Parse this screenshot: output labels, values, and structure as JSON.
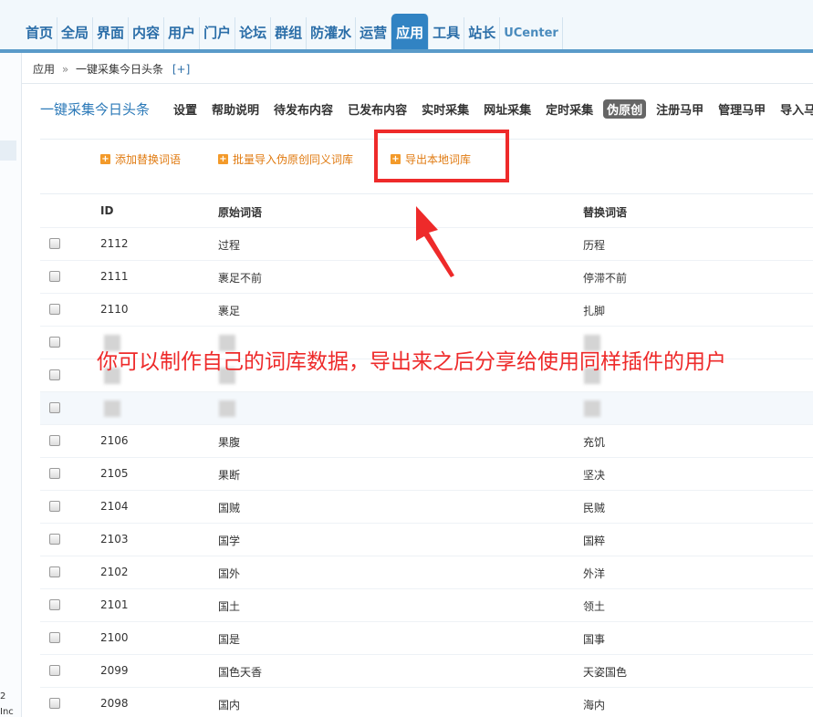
{
  "top_nav": {
    "items": [
      "首页",
      "全局",
      "界面",
      "内容",
      "用户",
      "门户",
      "论坛",
      "群组",
      "防灌水",
      "运营",
      "应用",
      "工具",
      "站长",
      "UCenter"
    ],
    "active": "应用"
  },
  "left_frame": {
    "fragment_1": "2",
    "fragment_2": "Inc"
  },
  "breadcrumb": {
    "root": "应用",
    "separator": "»",
    "current": "一键采集今日头条",
    "add": "[+]"
  },
  "plugin": {
    "title": "一键采集今日头条",
    "menu": [
      "设置",
      "帮助说明",
      "待发布内容",
      "已发布内容",
      "实时采集",
      "网址采集",
      "定时采集",
      "伪原创",
      "注册马甲",
      "管理马甲",
      "导入马甲"
    ],
    "active": "伪原创"
  },
  "actions": {
    "add_replace": "添加替换词语",
    "batch_import": "批量导入伪原创同义词库",
    "export_local": "导出本地词库"
  },
  "table": {
    "headers": {
      "id": "ID",
      "original": "原始词语",
      "replacement": "替换词语"
    },
    "rows": [
      {
        "id": "2112",
        "original": "过程",
        "replacement": "历程"
      },
      {
        "id": "2111",
        "original": "裹足不前",
        "replacement": "停滞不前"
      },
      {
        "id": "2110",
        "original": "裹足",
        "replacement": "扎脚"
      },
      {
        "id": "",
        "original": "",
        "replacement": ""
      },
      {
        "id": "",
        "original": "",
        "replacement": ""
      },
      {
        "id": "",
        "original": "",
        "replacement": ""
      },
      {
        "id": "2106",
        "original": "果腹",
        "replacement": "充饥"
      },
      {
        "id": "2105",
        "original": "果断",
        "replacement": "坚决"
      },
      {
        "id": "2104",
        "original": "国贼",
        "replacement": "民贼"
      },
      {
        "id": "2103",
        "original": "国学",
        "replacement": "国粹"
      },
      {
        "id": "2102",
        "original": "国外",
        "replacement": "外洋"
      },
      {
        "id": "2101",
        "original": "国土",
        "replacement": "领土"
      },
      {
        "id": "2100",
        "original": "国是",
        "replacement": "国事"
      },
      {
        "id": "2099",
        "original": "国色天香",
        "replacement": "天姿国色"
      },
      {
        "id": "2098",
        "original": "国内",
        "replacement": "海内"
      }
    ]
  },
  "annotation": {
    "text": "你可以制作自己的词库数据，导出来之后分享给使用同样插件的用户"
  },
  "colors": {
    "accent": "#3183c3",
    "highlight_red": "#ee2a2a",
    "action_orange": "#e07a10"
  },
  "icons": {
    "add": "plus-square-icon",
    "checkbox": "checkbox-icon",
    "pointer": "red-arrow-icon"
  }
}
